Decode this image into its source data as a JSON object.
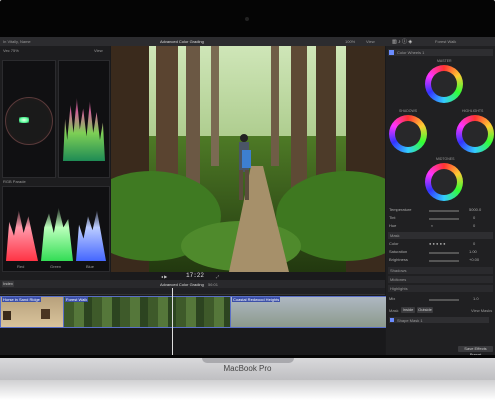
{
  "device": {
    "label": "MacBook Pro"
  },
  "app": {
    "library_title": "In Vitally, Name",
    "viewer_title": "Advanced Color Grading",
    "zoom": "100%",
    "view_label": "View",
    "inspector_title": "Forest Walk"
  },
  "scopes": {
    "header_left": "Vec 75%",
    "header_right": "View",
    "rgb_label": "RGB Parade",
    "parade_labels": [
      "Red",
      "Green",
      "Blue"
    ]
  },
  "viewer": {
    "timecode": "17:22"
  },
  "timeline": {
    "index_label": "Index",
    "project_title": "Advanced Color Grading",
    "duration": "56:01",
    "clips": [
      "Horse in Sand Ridge",
      "Forest Walk",
      "Coastal Redwood Heights"
    ]
  },
  "inspector": {
    "effect_name": "Color Wheels 1",
    "wheel_labels": [
      "MASTER",
      "SHADOWS",
      "HIGHLIGHTS",
      "MIDTONES"
    ],
    "params": [
      {
        "label": "Temperature",
        "value": "5000.0"
      },
      {
        "label": "Tint",
        "value": "0"
      },
      {
        "label": "Hue",
        "value": "0"
      }
    ],
    "mask_section": "Mask",
    "mask_params": [
      {
        "label": "Color",
        "value": "0"
      },
      {
        "label": "Saturation",
        "value": "1.00"
      },
      {
        "label": "Brightness",
        "value": "+0.00"
      }
    ],
    "sections": [
      "Shadows",
      "Midtones",
      "Highlights"
    ],
    "mix_label": "Mix",
    "mix_value": "1.0",
    "mask_buttons": [
      "Mask",
      "Inside",
      "Outside"
    ],
    "view_masks": "View Masks",
    "shape_mask": "Shape Mask 1",
    "save_preset": "Save Effects Preset"
  }
}
